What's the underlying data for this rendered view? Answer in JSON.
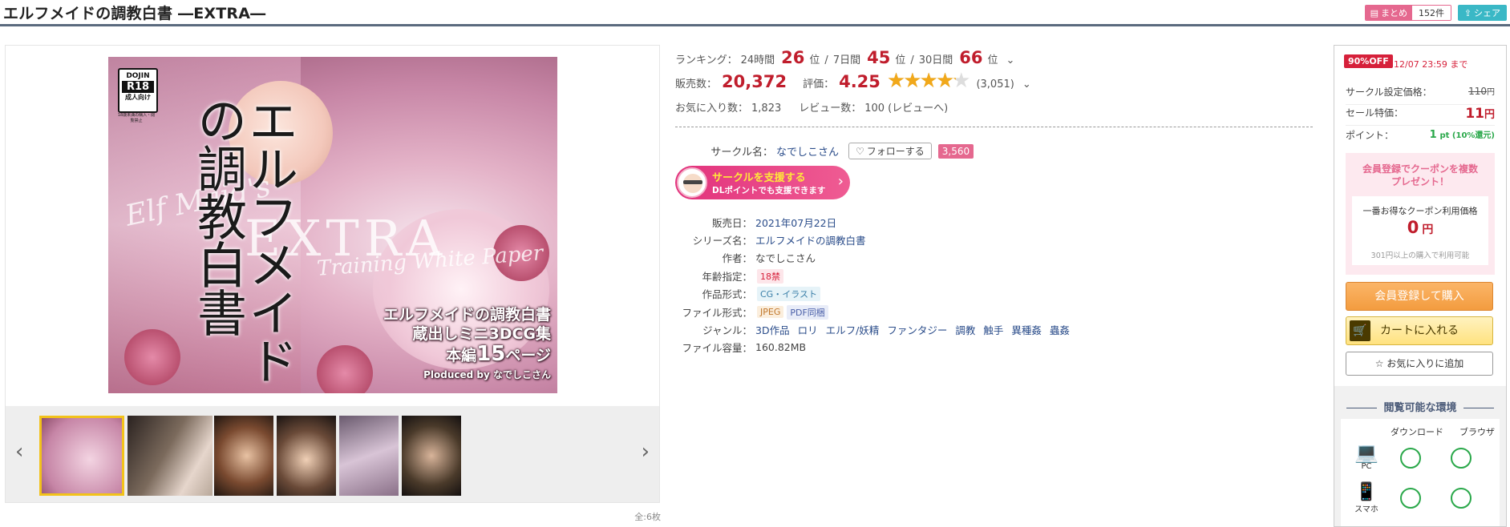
{
  "header": {
    "title": "エルフメイドの調教白書 ―EXTRA―",
    "matome_label": "まとめ",
    "matome_count": "152件",
    "share_label": "シェア"
  },
  "cover": {
    "dojin_top": "DOJIN",
    "dojin_mid": "R18",
    "dojin_bottom": "成人向け",
    "dojin_note": "18歳未満の購入・閲覧禁止",
    "vertical_title": "エルフメイドの調教白書",
    "extra_word": "EXTRA",
    "script_sub": "Elf Maid's",
    "script_sub2": "Training White Paper",
    "copy_line1": "エルフメイドの調教白書",
    "copy_line2": "蔵出しミニ3DCG集",
    "copy_line3a": "本編",
    "copy_line3b": "15",
    "copy_line3c": "ページ",
    "copy_line4": "Ploduced by なでしこさん"
  },
  "gallery": {
    "prev_label": "‹",
    "next_label": "›",
    "count_label": "全:6枚"
  },
  "ranking": {
    "label": "ランキング：",
    "d24_label": "24時間",
    "d24_value": "26",
    "d7_label": "7日間",
    "d7_value": "45",
    "d30_label": "30日間",
    "d30_value": "66",
    "unit": "位",
    "sep": "/"
  },
  "sales": {
    "label": "販売数：",
    "value": "20,372",
    "rating_label": "評価：",
    "rating_value": "4.25",
    "rating_count": "(3,051)",
    "rating_stars": 4.25
  },
  "counts": {
    "favorites_label": "お気に入り数：",
    "favorites_value": "1,823",
    "review_label": "レビュー数：",
    "review_value": "100",
    "review_link": "(レビューへ)"
  },
  "circle": {
    "label": "サークル名：",
    "name": "なでしこさん",
    "follow_label": "フォローする",
    "follow_count": "3,560",
    "support_line1": "サークルを支援する",
    "support_line2": "DLポイントでも支援できます"
  },
  "details": [
    {
      "label": "販売日：",
      "value": "2021年07月22日",
      "type": "link"
    },
    {
      "label": "シリーズ名：",
      "value": "エルフメイドの調教白書",
      "type": "link"
    },
    {
      "label": "作者：",
      "value": "なでしこさん",
      "type": "text"
    },
    {
      "label": "年齢指定：",
      "value": "18禁",
      "type": "age"
    },
    {
      "label": "作品形式：",
      "value": "CG・イラスト",
      "type": "form"
    },
    {
      "label": "ファイル形式：",
      "value": "JPEG",
      "value2": "PDF同梱",
      "type": "file"
    },
    {
      "label": "ジャンル：",
      "values": [
        "3D作品",
        "ロリ",
        "エルフ/妖精",
        "ファンタジー",
        "調教",
        "触手",
        "異種姦",
        "蟲姦"
      ],
      "type": "genre"
    },
    {
      "label": "ファイル容量：",
      "value": "160.82MB",
      "type": "text"
    }
  ],
  "panel": {
    "off_badge": "90%OFF",
    "off_date": "12/07 23:59 まで",
    "price_label": "サークル設定価格：",
    "price_value": "110",
    "price_unit": "円",
    "sale_label": "セール特価：",
    "sale_value": "11",
    "sale_unit": "円",
    "point_label": "ポイント：",
    "point_value": "1",
    "point_unit": "pt (10%還元)",
    "coupon_head1": "会員登録でクーポンを複数",
    "coupon_head2": "プレゼント！",
    "coupon_title": "一番お得なクーポン利用価格",
    "coupon_price": "0",
    "coupon_unit": "円",
    "coupon_note": "301円以上の購入で利用可能",
    "buy_label": "会員登録して購入",
    "cart_label": "カートに入れる",
    "fav_label": "お気に入りに追加",
    "env_title": "閲覧可能な環境",
    "env_download": "ダウンロード",
    "env_browser": "ブラウザ",
    "env_pc": "PC",
    "env_phone": "スマホ"
  },
  "colors": {
    "accent_red": "#c01d2c",
    "pink": "#e5688f",
    "link": "#2a4c8a",
    "teal": "#3ab8c6"
  }
}
